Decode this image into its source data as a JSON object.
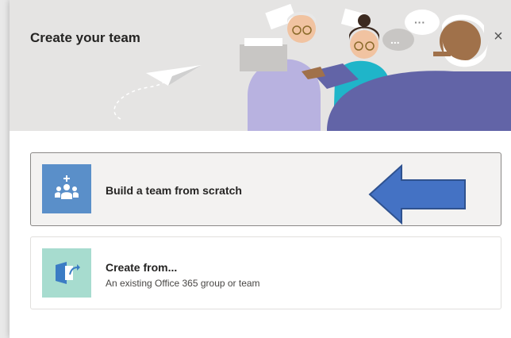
{
  "dialog": {
    "title": "Create your team",
    "close_label": "×"
  },
  "options": [
    {
      "title": "Build a team from scratch",
      "subtitle": "",
      "icon": "team-plus-icon",
      "state": "hovered"
    },
    {
      "title": "Create from...",
      "subtitle": "An existing Office 365 group or team",
      "icon": "export-icon",
      "state": "default"
    }
  ],
  "hero": {
    "chat_bubble_text": "...",
    "icon": "team-collaboration-illustration"
  },
  "annotation": {
    "icon": "left-arrow-icon",
    "color": "#4472c4"
  },
  "colors": {
    "accent_icon_bg": "#5a8fc9",
    "secondary_icon_bg": "#a7dccf",
    "hero_bg": "#e5e4e3"
  }
}
